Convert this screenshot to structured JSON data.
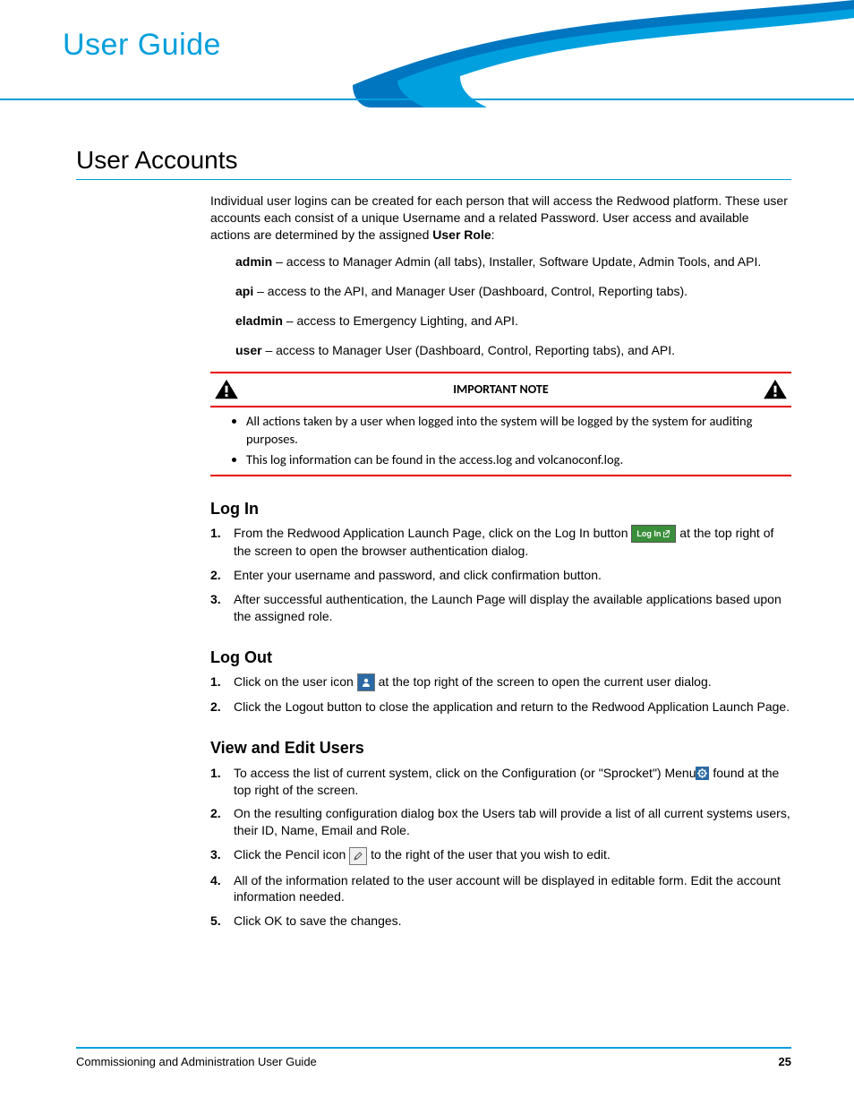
{
  "header": {
    "title": "User Guide"
  },
  "section": {
    "heading": "User Accounts",
    "intro": "Individual user logins can be created for each person that will access the Redwood platform. These user accounts each consist of a unique Username and a related Password. User access and available actions are determined by the assigned ",
    "intro_bold": "User Role",
    "intro_tail": ":",
    "roles": {
      "admin": {
        "name": "admin",
        "desc": " – access to Manager Admin (all tabs), Installer, Software Update, Admin Tools, and API."
      },
      "api": {
        "name": "api",
        "desc": " – access to the API, and Manager User (Dashboard, Control, Reporting tabs)."
      },
      "eladmin": {
        "name": "eladmin",
        "desc": " – access to Emergency Lighting, and API."
      },
      "user": {
        "name": "user",
        "desc": " – access to Manager User (Dashboard, Control, Reporting tabs), and API."
      }
    }
  },
  "note": {
    "title": "IMPORTANT NOTE",
    "items": [
      "All actions taken by a user when logged into the system will be logged by the system for auditing purposes.",
      "This log information can be found in the access.log and volcanoconf.log."
    ]
  },
  "login": {
    "heading": "Log In",
    "step1a": "From the Redwood Application Launch Page, click on the Log In button ",
    "btn_label": "Log In",
    "step1b": " at the top right of the screen to open the browser authentication dialog.",
    "step2": "Enter your username and password, and click confirmation button.",
    "step3": "After successful authentication, the Launch Page will display the available applications based upon the assigned role."
  },
  "logout": {
    "heading": "Log Out",
    "step1a": "Click on the user icon ",
    "step1b": " at the top right of the screen to open the current user dialog.",
    "step2": "Click the Logout button to close the application and return to the Redwood Application Launch Page."
  },
  "viewedit": {
    "heading": "View and Edit Users",
    "step1a": "To access the list of current system, click on the Configuration (or \"Sprocket\") Menu",
    "step1b": " found at the top right of the screen.",
    "step2": "On the resulting configuration dialog box the Users tab will provide a list of all current systems users, their ID, Name, Email and Role.",
    "step3a": "Click the Pencil icon ",
    "step3b": " to the right of the user that you wish to edit.",
    "step4": "All of the information related to the user account will be displayed in editable form. Edit the account information needed.",
    "step5": "Click OK to save the changes."
  },
  "footer": {
    "title": "Commissioning and Administration User Guide",
    "page": "25"
  }
}
